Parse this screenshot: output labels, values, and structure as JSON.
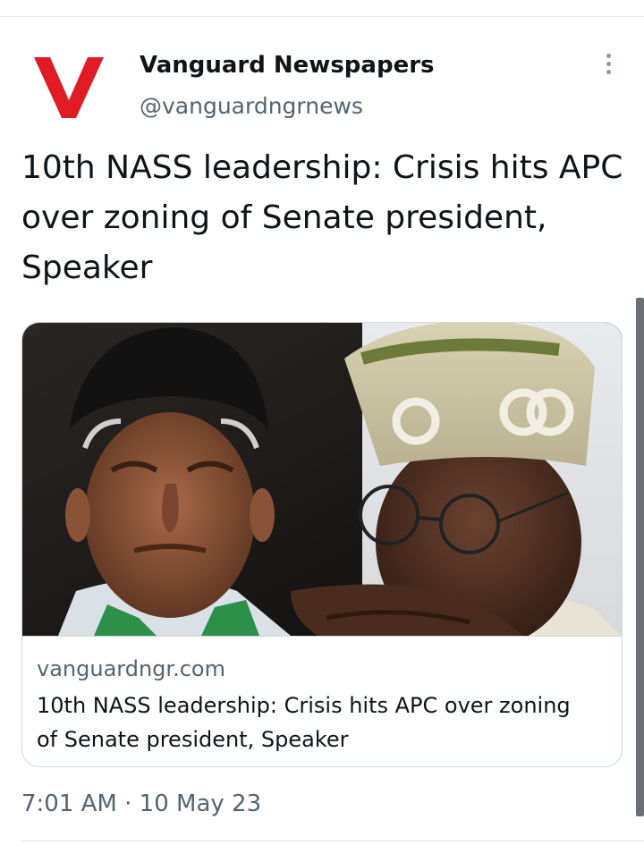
{
  "account": {
    "name": "Vanguard Newspapers",
    "handle": "@vanguardngrnews",
    "logo_letter": "V",
    "logo_color": "#e01b24"
  },
  "tweet": {
    "text": "10th NASS leadership: Crisis hits APC over zoning of Senate president, Speaker",
    "time": "7:01 AM",
    "separator": "·",
    "date": "10 May 23"
  },
  "card": {
    "domain": "vanguardngr.com",
    "title": "10th NASS leadership: Crisis hits APC over zoning of Senate president, Speaker",
    "image_description_icon": "news-photo"
  },
  "colors": {
    "text_primary": "#0f1419",
    "text_secondary": "#536471",
    "border": "#cfd9de"
  }
}
